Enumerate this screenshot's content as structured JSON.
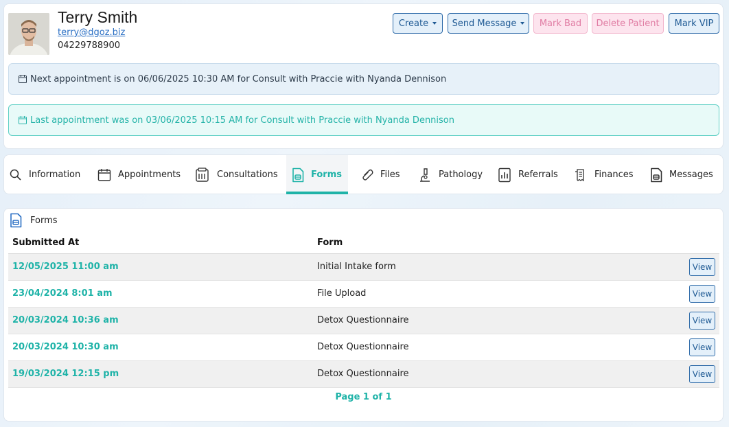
{
  "patient": {
    "name": "Terry Smith",
    "email": "terry@dgoz.biz",
    "phone": "04229788900"
  },
  "actions": {
    "create": "Create",
    "send_message": "Send Message",
    "mark_bad": "Mark Bad",
    "delete_patient": "Delete Patient",
    "mark_vip": "Mark VIP"
  },
  "appointments": {
    "next": "Next appointment is on 06/06/2025 10:30 AM for Consult with Praccie with Nyanda Dennison",
    "last": "Last appointment was on 03/06/2025 10:15 AM for Consult with Praccie with Nyanda Dennison"
  },
  "tabs": [
    {
      "label": "Information",
      "icon": "search-icon"
    },
    {
      "label": "Appointments",
      "icon": "calendar-icon"
    },
    {
      "label": "Consultations",
      "icon": "clipboard-icon"
    },
    {
      "label": "Forms",
      "icon": "form-icon",
      "active": true
    },
    {
      "label": "Files",
      "icon": "paperclip-icon"
    },
    {
      "label": "Pathology",
      "icon": "microscope-icon"
    },
    {
      "label": "Referrals",
      "icon": "chart-doc-icon"
    },
    {
      "label": "Finances",
      "icon": "receipt-icon"
    },
    {
      "label": "Messages",
      "icon": "message-doc-icon"
    }
  ],
  "forms": {
    "title": "Forms",
    "columns": {
      "submitted": "Submitted At",
      "form": "Form"
    },
    "view_label": "View",
    "rows": [
      {
        "submitted": "12/05/2025 11:00 am",
        "form": "Initial Intake form"
      },
      {
        "submitted": "23/04/2024 8:01 am",
        "form": "File Upload"
      },
      {
        "submitted": "20/03/2024 10:36 am",
        "form": "Detox Questionnaire"
      },
      {
        "submitted": "20/03/2024 10:30 am",
        "form": "Detox Questionnaire"
      },
      {
        "submitted": "19/03/2024 12:15 pm",
        "form": "Detox Questionnaire"
      }
    ],
    "pager": "Page 1 of 1"
  },
  "colors": {
    "accent_teal": "#1fb3a8",
    "primary_blue": "#1f5a94",
    "danger_pink": "#e07ca3"
  }
}
